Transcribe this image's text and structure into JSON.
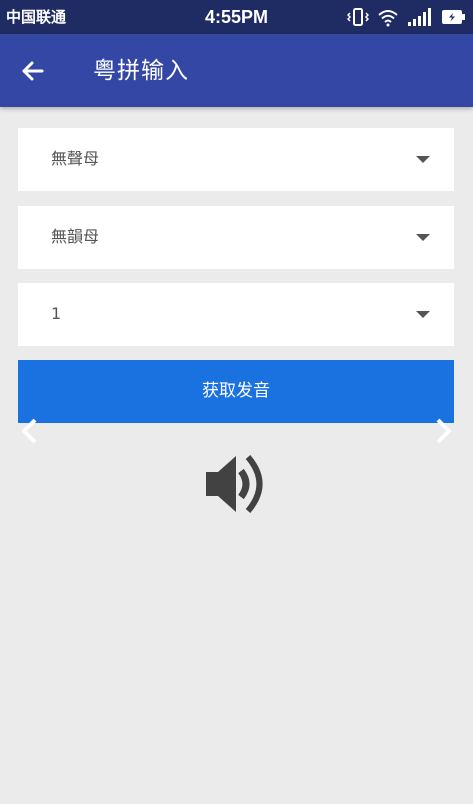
{
  "status_bar": {
    "carrier": "中国联通",
    "time": "4:55PM",
    "icons": [
      "vibrate-icon",
      "wifi-icon",
      "signal-icon",
      "battery-icon"
    ]
  },
  "app_bar": {
    "back_icon": "arrow-left-icon",
    "title": "粤拼输入"
  },
  "form": {
    "initial_select": {
      "value": "無聲母",
      "icon": "caret-down-icon"
    },
    "final_select": {
      "value": "無韻母",
      "icon": "caret-down-icon"
    },
    "tone_select": {
      "value": "1",
      "icon": "caret-down-icon"
    },
    "submit_label": "获取发音"
  },
  "pager": {
    "prev_icon": "chevron-left-icon",
    "next_icon": "chevron-right-icon"
  },
  "audio": {
    "icon": "speaker-icon"
  },
  "colors": {
    "status_bar": "#1f2b63",
    "app_bar": "#3547a5",
    "button": "#1a72e0",
    "background": "#ebebeb"
  }
}
